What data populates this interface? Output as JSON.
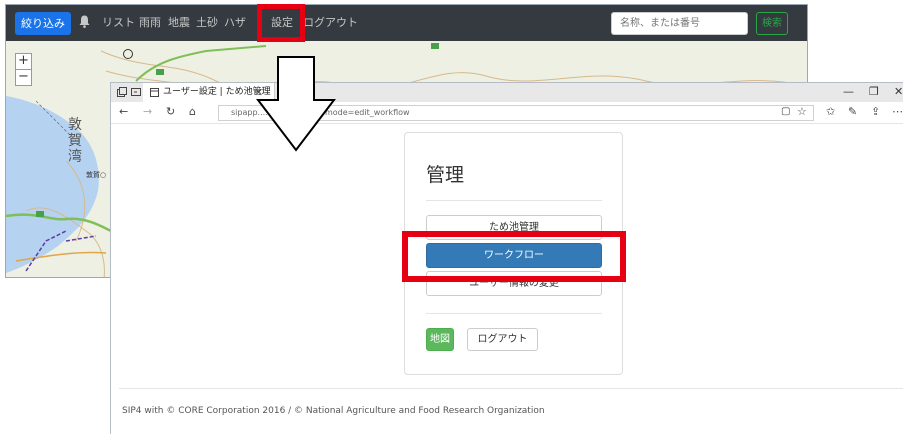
{
  "map_app": {
    "filter_label": "絞り込み",
    "nav": [
      "リスト",
      "雨雨",
      "地震",
      "土砂",
      "ハザ",
      "設定",
      "ログアウト"
    ],
    "bell_icon": "bell-icon",
    "search_placeholder": "名称、または番号",
    "search_label": "検索",
    "zoom_in": "+",
    "zoom_out": "−",
    "map_labels": {
      "bay": "敦賀湾",
      "station": "敦賀"
    }
  },
  "browser": {
    "tab_title": "ユーザー設定 | ため池管理",
    "url": "sipapp...................ion/?mode=edit_workflow",
    "window_controls": [
      "—",
      "❐",
      "✕"
    ]
  },
  "admin": {
    "title": "管理",
    "menu": [
      "ため池管理",
      "ワークフロー",
      "ユーザー情報の変更"
    ],
    "map_button": "地図",
    "logout_button": "ログアウト"
  },
  "footer": "SIP4 with © CORE Corporation 2016 / © National Agriculture and Food Research Organization",
  "colors": {
    "highlight": "#e60012",
    "primary": "#337ab7",
    "success": "#5cb85c",
    "navbar": "#343a40"
  }
}
